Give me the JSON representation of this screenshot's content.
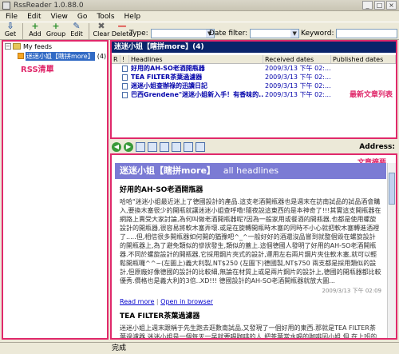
{
  "window": {
    "title": "RssReader 1.0.88.0",
    "min": "_",
    "max": "□",
    "close": "×"
  },
  "menu": [
    "File",
    "Edit",
    "View",
    "Go",
    "Tools",
    "Help"
  ],
  "toolbar": [
    {
      "label": "Get",
      "icon": "get-icon",
      "glyph": "⇩",
      "color": "#2c5aa0"
    },
    {
      "label": "Add",
      "icon": "add-icon",
      "glyph": "+",
      "color": "#2a8f2a"
    },
    {
      "label": "Group",
      "icon": "group-icon",
      "glyph": "+",
      "color": "#2a8f2a"
    },
    {
      "label": "Edit",
      "icon": "edit-icon",
      "glyph": "✎",
      "color": "#2c5aa0"
    },
    {
      "label": "Clear",
      "icon": "clear-icon",
      "glyph": "✖",
      "color": "#666"
    },
    {
      "label": "Delete",
      "icon": "delete-icon",
      "glyph": "—",
      "color": "#d22"
    }
  ],
  "filters": {
    "type_label": "Type:",
    "type_value": "All",
    "date_label": "Date filter:",
    "date_value": "All",
    "keyword_label": "Keyword:",
    "keyword_value": ""
  },
  "tree": {
    "root_label": "My feeds",
    "feed_label": "迷迷小姐【瞎拼more】",
    "feed_count": "(4)",
    "annotation": "RSS清單"
  },
  "headlines": {
    "title": "迷迷小姐【瞎拼more】(4)",
    "annotation": "最新文章列表",
    "columns": [
      "R",
      "!",
      "Headlines",
      "Received dates",
      "Published dates"
    ],
    "rows": [
      {
        "headline": "好用的AH-SO老酒開瓶器",
        "received": "2009/3/13 下午 02:...",
        "published": ""
      },
      {
        "headline": "TEA FILTER茶葉過濾器",
        "received": "2009/3/13 下午 02:...",
        "published": ""
      },
      {
        "headline": "迷迷小姐查辦祿的迅讀日記",
        "received": "2009/3/13 下午 02:...",
        "published": ""
      },
      {
        "headline": "巴西Grendene\"迷迷小姐新入手！有香味的...",
        "received": "2009/3/13 下午 02:...",
        "published": ""
      }
    ]
  },
  "nav": {
    "address_label": "Address:"
  },
  "article": {
    "annotation": "文章摘要",
    "banner_title": "迷迷小姐【瞎拼more】",
    "banner_sub": "all headlines",
    "post1_title": "好用的AH-SO老酒開瓶器",
    "post1_body": "哈哈\"迷迷小姐最近迷上了德國設計的產品.這支老酒開瓶器也是週末在訪南試品的試品酒會購入,要換木塞很少的開瓶就讓迷迷小姐查呼嚕!隨夜說這東西的是本神奇了!!!其實這支開瓶器在網路上賣受大家討論,為何叫做老酒開瓶器呢?因為一般家用或餐酒的開瓶器,也都是使用螺旋設計的開瓶器,很容易將軟木塞弄壞.或是在旋轉開瓶時木塞的同時不小心就把軟木塞轉進酒裡了.....但,相信很多開瓶器如何開的猶豫吧^_^一般好好的酒還沒品嘗到就整個毀在螺旋設計的開瓶器上,為了避免類似的慘狀發生,類似的蓋上.這個德國人發明了好用的AH-SO老酒開瓶器.不同於螺旋設計的開瓶器,它採用鋼片夾式的設計,運用左右兩片鋼片夾住軟木塞,就可以輕鬆開瓶囉^^~(左圖上)義大利製,NT$250 (左圖下)德國製,NT$750 兩支都是採用類似的設計,但原廠好像德國的設計的比較細,無論在材質上或是兩片鋼片的設計上,德國的開瓶器都比較優秀.價格也是義大利的3倍..XD!!! 德國設計的AH-SO老酒開瓶器就放大圖...",
    "post1_date": "2009/3/13 下午 02:09",
    "read_more": "Read more",
    "link_sep": "|",
    "open_browser": "Open in browser",
    "post2_title": "TEA FILTER茶葉過濾器",
    "post2_body": "迷迷小姐上週末跟稱于先生跑去逛數南試品,又發現了一個好用的東西.那就是TEA FILTER茶葉過濾器.迷迷小姐是一個每天一早就要喝咖啡的人.把茶葉當水喝的咖啡因小姐.但,在上班的時間實在無法好好泡一壺好茶來品嘗.市售的茶包也找不到..."
  },
  "status": "完成"
}
